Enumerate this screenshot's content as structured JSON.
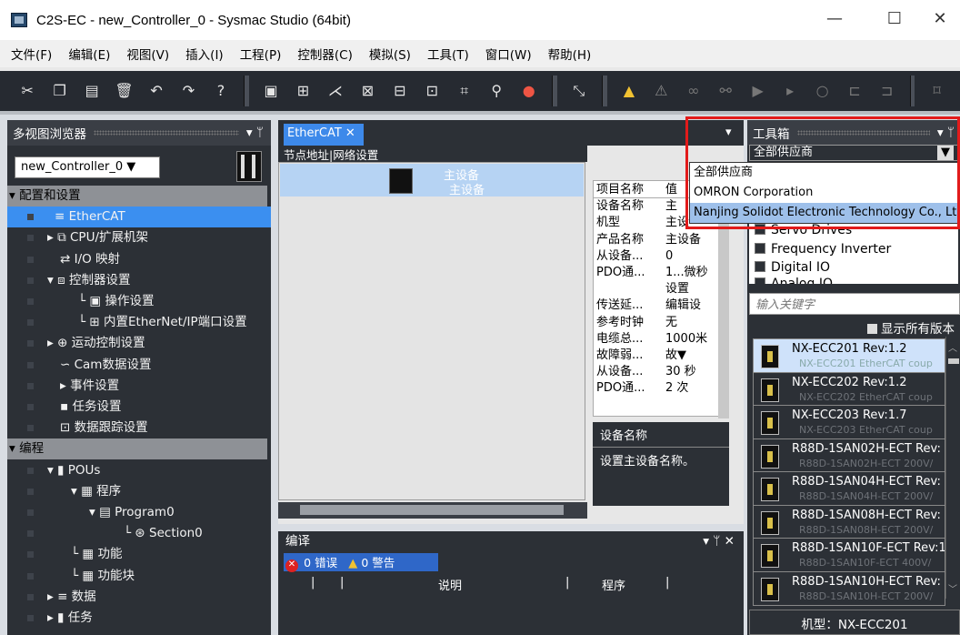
{
  "window": {
    "title": "C2S-EC - new_Controller_0 - Sysmac Studio (64bit)",
    "min": "—",
    "max": "☐",
    "close": "✕"
  },
  "menu": [
    "文件(F)",
    "编辑(E)",
    "视图(V)",
    "插入(I)",
    "工程(P)",
    "控制器(C)",
    "模拟(S)",
    "工具(T)",
    "窗口(W)",
    "帮助(H)"
  ],
  "toolbar_icons": [
    "cut-icon",
    "copy-icon",
    "paste-icon",
    "delete-icon",
    "undo-icon",
    "redo-icon",
    "help-icon",
    "3d-icon",
    "build-icon",
    "online-icon",
    "monitor-icon",
    "sync-icon",
    "transfer-icon",
    "grid-icon",
    "search-icon",
    "record-icon",
    "stop-icon",
    "warning-icon",
    "warning2-icon",
    "link-icon",
    "unlink-icon",
    "forward-icon",
    "step-icon",
    "reset-icon",
    "network-icon",
    "node-icon",
    "window-icon"
  ],
  "left_panel": {
    "title": "多视图浏览器",
    "pin": "▾ ‍ᛘ",
    "controller": "new_Controller_0 ▼",
    "tree": [
      {
        "label": "▾ 配置和设置",
        "type": "cat",
        "indent": 2
      },
      {
        "label": "≡ EtherCAT",
        "type": "sel",
        "indent": 52
      },
      {
        "label": "▸ ⧉ CPU/扩展机架",
        "type": "item",
        "indent": 44
      },
      {
        "label": "⇄ I/O 映射",
        "type": "item",
        "indent": 58
      },
      {
        "label": "▾ ⧈ 控制器设置",
        "type": "item",
        "indent": 44
      },
      {
        "label": "└ ▣ 操作设置",
        "type": "item",
        "indent": 78
      },
      {
        "label": "└ ⊞ 内置EtherNet/IP端口设置",
        "type": "item",
        "indent": 78
      },
      {
        "label": "▸ ⊕ 运动控制设置",
        "type": "item",
        "indent": 44
      },
      {
        "label": "∽ Cam数据设置",
        "type": "item",
        "indent": 58
      },
      {
        "label": "▸ 事件设置",
        "type": "item",
        "indent": 58
      },
      {
        "label": "▪ 任务设置",
        "type": "item",
        "indent": 58
      },
      {
        "label": "⊡ 数据跟踪设置",
        "type": "item",
        "indent": 58
      },
      {
        "label": "▾ 编程",
        "type": "cat",
        "indent": 2
      },
      {
        "label": "▾ ▮ POUs",
        "type": "item",
        "indent": 44
      },
      {
        "label": "▾ ▦ 程序",
        "type": "item",
        "indent": 70
      },
      {
        "label": "▾ ▤ Program0",
        "type": "item",
        "indent": 90
      },
      {
        "label": "└ ⊛ Section0",
        "type": "item",
        "indent": 128
      },
      {
        "label": "└ ▦ 功能",
        "type": "item",
        "indent": 70
      },
      {
        "label": "└ ▦ 功能块",
        "type": "item",
        "indent": 70
      },
      {
        "label": "▸ ≡ 数据",
        "type": "item",
        "indent": 44
      },
      {
        "label": "▸ ▮ 任务",
        "type": "item",
        "indent": 44
      }
    ]
  },
  "editor": {
    "tab": "EtherCAT ✕",
    "net_header": "节点地址|网络设置",
    "master_line1": "主设备",
    "master_line2": "主设备",
    "dropdown_arrow": "▾",
    "properties": [
      {
        "k": "项目名称",
        "v": "值"
      },
      {
        "k": "设备名称",
        "v": "主"
      },
      {
        "k": "机型",
        "v": "主设"
      },
      {
        "k": "产品名称",
        "v": "主设备"
      },
      {
        "k": "从设备...",
        "v": "0"
      },
      {
        "k": "PDO通...",
        "v": "1...微秒"
      },
      {
        "k": "",
        "v": "设置"
      },
      {
        "k": "传送延...",
        "v": "编辑设"
      },
      {
        "k": "参考时钟",
        "v": "无"
      },
      {
        "k": "电缆总...",
        "v": "1000米"
      },
      {
        "k": "故障弱...",
        "v": "故▼"
      },
      {
        "k": "从设备...",
        "v": "30 秒"
      },
      {
        "k": "PDO通...",
        "v": "2 次"
      }
    ],
    "desc_title": "设备名称",
    "desc_text": "设置主设备名称。"
  },
  "compile": {
    "title": "编译",
    "errors": "0 错误",
    "warnings": "0 警告",
    "col_desc": "说明",
    "col_prog": "程序",
    "controls": "▾ ᛘ ✕"
  },
  "toolbox": {
    "title": "工具箱",
    "vendor_selected": "全部供应商",
    "vendors": [
      "全部供应商",
      "OMRON Corporation",
      "Nanjing Solidot Electronic Technology Co., Ltd"
    ],
    "highlighted_vendor_index": 2,
    "groups": [
      "Servo Drives",
      "Frequency Inverter",
      "Digital IO",
      "Analog IO"
    ],
    "keyword_placeholder": "输入关键字",
    "show_all": "显示所有版本",
    "devices": [
      {
        "name": "NX-ECC201 Rev:1.2",
        "desc": "NX-ECC201 EtherCAT coup",
        "selected": true
      },
      {
        "name": "NX-ECC202 Rev:1.2",
        "desc": "NX-ECC202 EtherCAT coup",
        "selected": false
      },
      {
        "name": "NX-ECC203 Rev:1.7",
        "desc": "NX-ECC203 EtherCAT coup",
        "selected": false
      },
      {
        "name": "R88D-1SAN02H-ECT Rev:",
        "desc": "R88D-1SAN02H-ECT 200V/",
        "selected": false
      },
      {
        "name": "R88D-1SAN04H-ECT Rev:",
        "desc": "R88D-1SAN04H-ECT 200V/",
        "selected": false
      },
      {
        "name": "R88D-1SAN08H-ECT Rev:",
        "desc": "R88D-1SAN08H-ECT 200V/",
        "selected": false
      },
      {
        "name": "R88D-1SAN10F-ECT Rev:1",
        "desc": "R88D-1SAN10F-ECT 400V/",
        "selected": false
      },
      {
        "name": "R88D-1SAN10H-ECT Rev:",
        "desc": "R88D-1SAN10H-ECT 200V/",
        "selected": false
      }
    ],
    "model_label": "机型：NX-ECC201"
  },
  "colors": {
    "accent": "#3b8ff0",
    "highlight_rect": "#e21b1b",
    "panel_bg": "#2c3036"
  }
}
